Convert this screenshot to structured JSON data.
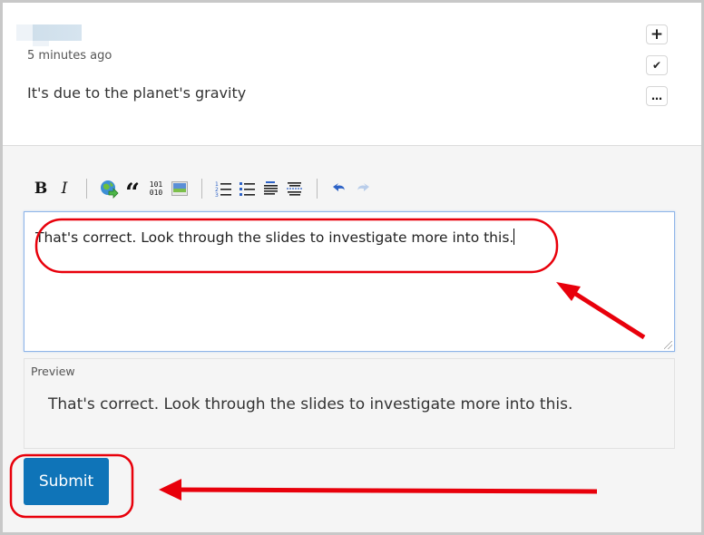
{
  "comment": {
    "author": "",
    "timestamp": "5 minutes ago",
    "text": "It's due to the planet's gravity",
    "actions": [
      {
        "name": "add",
        "icon": "plus-icon",
        "glyph": "+"
      },
      {
        "name": "endorse",
        "icon": "check-icon",
        "glyph": "✔"
      },
      {
        "name": "more",
        "icon": "more-icon",
        "glyph": "…"
      }
    ]
  },
  "toolbar": {
    "bold": "B",
    "italic": "I",
    "quote": "“",
    "code_top": "101",
    "code_bottom": "010"
  },
  "editor": {
    "value": "That's correct. Look through the slides to investigate more into this."
  },
  "preview": {
    "label": "Preview",
    "text": "That's correct. Look through the slides to investigate more into this."
  },
  "submit": {
    "label": "Submit"
  },
  "annotation_colors": {
    "highlight": "#e8000b"
  }
}
